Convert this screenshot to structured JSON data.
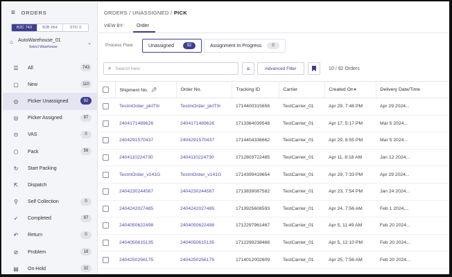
{
  "sidebar": {
    "title": "ORDERS",
    "segments": [
      {
        "label": "B2C",
        "count": "743",
        "active": true
      },
      {
        "label": "B2B",
        "count": "654"
      },
      {
        "label": "STO",
        "count": "0"
      }
    ],
    "warehouse": {
      "name": "AutoWarehouse_01",
      "sub": "Select Warehouse"
    },
    "items": [
      {
        "label": "All",
        "count": "743",
        "icon": "list-icon"
      },
      {
        "label": "New",
        "count": "110",
        "icon": "document-icon"
      },
      {
        "label": "Picker Unassigned",
        "count": "92",
        "icon": "target-icon",
        "active": true
      },
      {
        "label": "Picker Assigned",
        "count": "87",
        "icon": "target-icon"
      },
      {
        "label": "VAS",
        "count": "0",
        "icon": "play-circle-icon"
      },
      {
        "label": "Pack",
        "count": "56",
        "icon": "box-icon"
      },
      {
        "label": "Start Packing",
        "count": null,
        "icon": "refresh-icon"
      },
      {
        "label": "Dispatch",
        "count": null,
        "icon": "export-icon"
      },
      {
        "label": "Self Collection",
        "count": "0",
        "icon": "pin-icon"
      },
      {
        "label": "Completed",
        "count": "97",
        "icon": "check-circle-icon"
      },
      {
        "label": "Return",
        "count": "0",
        "icon": "return-icon"
      },
      {
        "label": "Problem",
        "count": "18",
        "icon": "alert-icon"
      },
      {
        "label": "On-Hold",
        "count": "32",
        "icon": "hold-icon"
      }
    ]
  },
  "main": {
    "breadcrumb": {
      "part1": "ORDERS",
      "sep": "/",
      "part2": "UNASSIGNED",
      "part3": "PICK"
    },
    "view_by": "VIEW BY:",
    "tab": "Order",
    "process_flow": {
      "label": "Process Flow:",
      "unassigned": {
        "label": "Unassigned",
        "count": "92"
      },
      "assign": {
        "label": "Assignment In Progress",
        "count": "0"
      }
    },
    "search": {
      "placeholder": "Search here"
    },
    "advanced_filter": "Advanced Filter",
    "count_text": "10 / 92 Orders",
    "columns": [
      "Shipment No.",
      "Order No.",
      "Tracking ID",
      "Carrier",
      "Created On",
      "Delivery Date/Time"
    ],
    "rows": [
      [
        "TestmOrder_pktT0r",
        "TestmOrder_pktT0r",
        "1714400315656",
        "TestCarrier_01",
        "Apr 29, 7:48 PM",
        "Apr 29 2024..."
      ],
      [
        "2404171489626",
        "2404171489626",
        "1713364039548",
        "TestCarrier_01",
        "Apr 17, 5:17 PM",
        "Mar 5 2024..."
      ],
      [
        "2404291570437",
        "2404291570437",
        "1714404336662",
        "TestCarrier_01",
        "Apr 29, 8:55 PM",
        "Mar 5 2024..."
      ],
      [
        "2404110224730",
        "2404110224730",
        "1712803722485",
        "TestCarrier_01",
        "Apr 11, 8:18 AM",
        "Jan 12 2024..."
      ],
      [
        "TestmOrder_v141G",
        "TestmOrder_v141G",
        "1714399419654",
        "TestCarrier_01",
        "Apr 29, 7:33 PM",
        "Apr 29 2024..."
      ],
      [
        "2404230244567",
        "2404230244567",
        "1713839087582",
        "TestCarrier_01",
        "Apr 23, 7:54 PM",
        "Jan 24 2024..."
      ],
      [
        "2404242027485",
        "2404242027485",
        "1713925608593",
        "TestCarrier_01",
        "Apr 24, 7:56 AM",
        "Feb 1 2024,..."
      ],
      [
        "2404050622498",
        "2404050622498",
        "1712297961467",
        "TestCarrier_01",
        "Apr 5, 11:49 AM",
        "Feb 20 2024..."
      ],
      [
        "2404050615135",
        "2404050615135",
        "1712299238468",
        "TestCarrier_01",
        "Apr 5, 12:10 PM",
        "Feb 20 2024..."
      ],
      [
        "2404250256175",
        "2404250256175",
        "1714012002609",
        "TestCarrier_01",
        "Apr 25, 7:56 AM",
        "Feb 20 2024..."
      ]
    ]
  },
  "colors": {
    "accent": "#3e3f8f",
    "link": "#4b4ca2"
  }
}
